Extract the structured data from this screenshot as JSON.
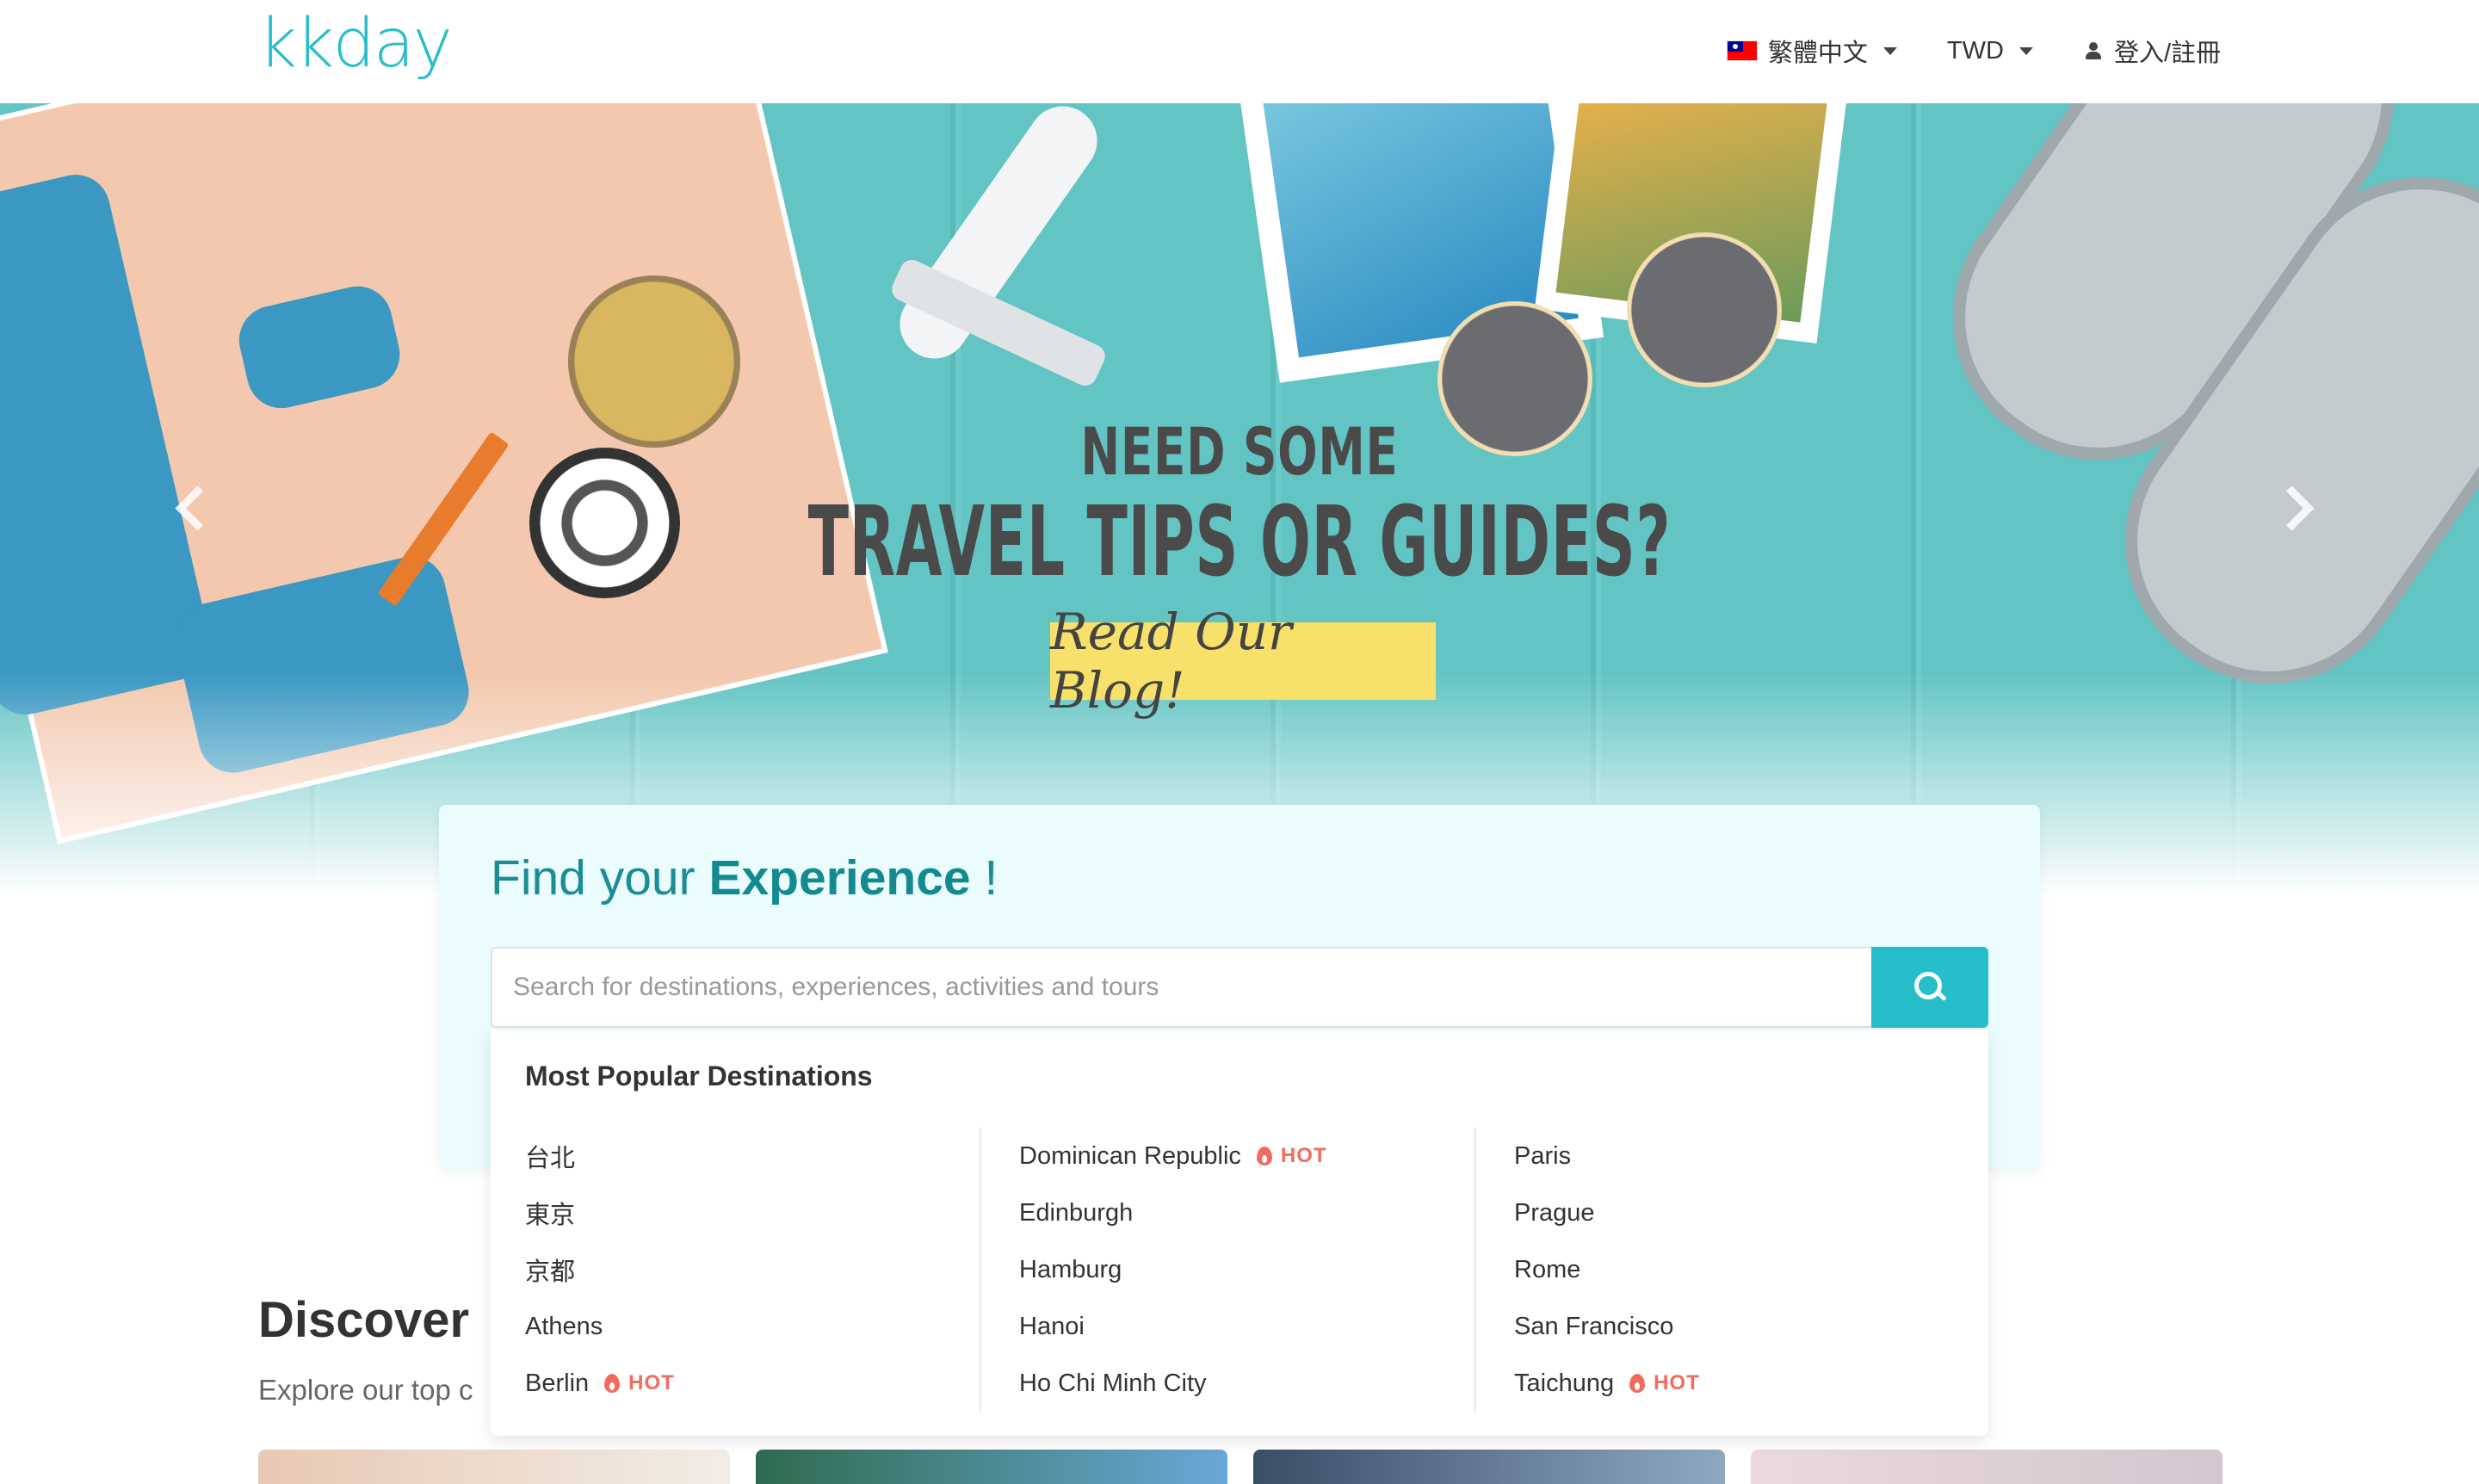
{
  "header": {
    "logo": "kkday",
    "language": "繁體中文",
    "currency": "TWD",
    "login": "登入/註冊"
  },
  "hero": {
    "line1": "NEED SOME",
    "line2": "TRAVEL TIPS OR GUIDES?",
    "cta": "Read Our Blog!"
  },
  "search": {
    "title_prefix": "Find your ",
    "title_bold": "Experience",
    "title_suffix": " !",
    "placeholder": "Search for destinations, experiences, activities and tours"
  },
  "dropdown": {
    "title": "Most Popular Destinations",
    "hot_label": "HOT",
    "columns": [
      [
        {
          "name": "台北",
          "hot": false
        },
        {
          "name": "東京",
          "hot": false
        },
        {
          "name": "京都",
          "hot": false
        },
        {
          "name": "Athens",
          "hot": false
        },
        {
          "name": "Berlin",
          "hot": true
        }
      ],
      [
        {
          "name": "Dominican Republic",
          "hot": true
        },
        {
          "name": "Edinburgh",
          "hot": false
        },
        {
          "name": "Hamburg",
          "hot": false
        },
        {
          "name": "Hanoi",
          "hot": false
        },
        {
          "name": "Ho Chi Minh City",
          "hot": false
        }
      ],
      [
        {
          "name": "Paris",
          "hot": false
        },
        {
          "name": "Prague",
          "hot": false
        },
        {
          "name": "Rome",
          "hot": false
        },
        {
          "name": "San Francisco",
          "hot": false
        },
        {
          "name": "Taichung",
          "hot": true
        }
      ]
    ]
  },
  "discover": {
    "title": "Discover",
    "subtitle": "Explore our top c"
  },
  "colors": {
    "brand": "#26bec9",
    "title_teal": "#1a8d96",
    "hot": "#f36b5e",
    "cta_yellow": "#f8e16a"
  }
}
